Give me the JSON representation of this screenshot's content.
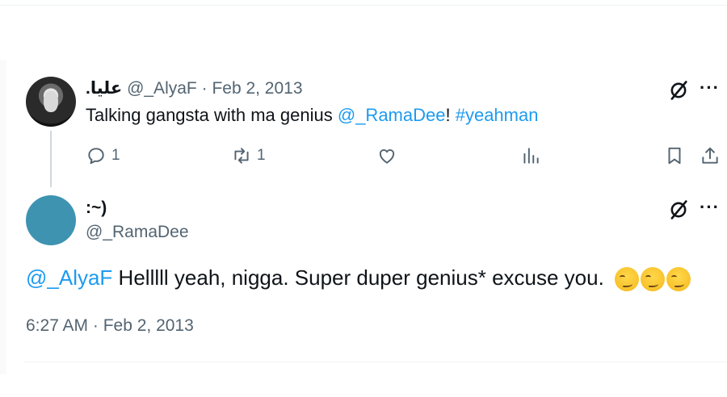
{
  "parent_tweet": {
    "display_name": "عليا.",
    "handle": "@_AlyaF",
    "separator": "·",
    "date": "Feb 2, 2013",
    "text_before": "Talking gangsta with ma genius ",
    "mention": "@_RamaDee",
    "text_between": "! ",
    "hashtag": "#yeahman",
    "reply_count": "1",
    "retweet_count": "1"
  },
  "reply_tweet": {
    "display_name": ":~)",
    "handle": "@_RamaDee",
    "mention": "@_AlyaF",
    "text": " Helllll yeah, nigga. Super duper genius* excuse you. ",
    "emoji_count": 3,
    "timestamp": "6:27 AM · Feb 2, 2013"
  },
  "colors": {
    "link": "#1d9bf0",
    "muted": "#536471",
    "avatar_reply": "#3e93b1"
  },
  "icons": [
    "reply-icon",
    "retweet-icon",
    "like-icon",
    "views-icon",
    "bookmark-icon",
    "share-icon",
    "grok-icon",
    "more-icon"
  ]
}
